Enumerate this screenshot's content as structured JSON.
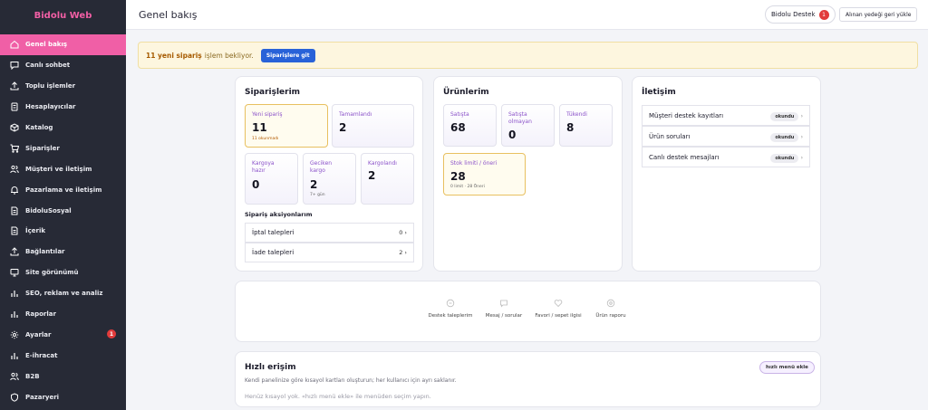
{
  "sidebar": {
    "brand": "Bidolu Web",
    "items": [
      {
        "label": "Genel bakış",
        "icon": "home-icon",
        "active": true
      },
      {
        "label": "Canlı sohbet",
        "icon": "chat-icon"
      },
      {
        "label": "Toplu işlemler",
        "icon": "upload-icon"
      },
      {
        "label": "Hesaplayıcılar",
        "icon": "calculator-icon"
      },
      {
        "label": "Katalog",
        "icon": "box-icon"
      },
      {
        "label": "Siparişler",
        "icon": "cart-icon"
      },
      {
        "label": "Müşteri ve iletişim",
        "icon": "users-icon"
      },
      {
        "label": "Pazarlama ve iletişim",
        "icon": "bell-icon"
      },
      {
        "label": "BidoluSosyal",
        "icon": "document-icon"
      },
      {
        "label": "İçerik",
        "icon": "document-icon"
      },
      {
        "label": "Bağlantılar",
        "icon": "upload-icon"
      },
      {
        "label": "Site görünümü",
        "icon": "monitor-icon"
      },
      {
        "label": "SEO, reklam ve analiz",
        "icon": "bar-chart-icon"
      },
      {
        "label": "Raporlar",
        "icon": "bar-chart-icon"
      },
      {
        "label": "Ayarlar",
        "icon": "settings-icon",
        "badge": "1"
      },
      {
        "label": "E-ihracat",
        "icon": "bar-chart-icon"
      },
      {
        "label": "B2B",
        "icon": "users-icon"
      },
      {
        "label": "Pazaryeri",
        "icon": "shield-icon"
      }
    ]
  },
  "header": {
    "title": "Genel bakış",
    "support_label": "Bidolu Destek",
    "support_badge": "1",
    "restore_label": "Alınan yedeği geri yükle"
  },
  "notice": {
    "bold": "11 yeni sipariş",
    "text": "işlem bekliyor.",
    "button": "Siparişlere git"
  },
  "orders": {
    "title": "Siparişlerim",
    "stats": [
      {
        "label": "Yeni sipariş",
        "value": "11",
        "sub": "11 okunmadı"
      },
      {
        "label": "Tamamlandı",
        "value": "2"
      },
      {
        "label": "Kargoya hazır",
        "value": "0"
      },
      {
        "label": "Geciken kargo",
        "value": "2",
        "sub": "7+ gün"
      },
      {
        "label": "Kargolandı",
        "value": "2"
      }
    ],
    "actions_title": "Sipariş aksiyonlarım",
    "actions": [
      {
        "label": "İptal talepleri",
        "count": "0 ›"
      },
      {
        "label": "İade talepleri",
        "count": "2 ›"
      }
    ]
  },
  "products": {
    "title": "Ürünlerim",
    "stats": [
      {
        "label": "Satışta",
        "value": "68"
      },
      {
        "label": "Satışta olmayan",
        "value": "0"
      },
      {
        "label": "Tükendi",
        "value": "8"
      },
      {
        "label": "Stok limiti / öneri",
        "value": "28",
        "sub": "0 limit · 28 Öneri"
      }
    ]
  },
  "contact": {
    "title": "İletişim",
    "rows": [
      {
        "label": "Müşteri destek kayıtları",
        "pill": "okundu",
        "arrow": "›"
      },
      {
        "label": "Ürün soruları",
        "pill": "okundu",
        "arrow": "›"
      },
      {
        "label": "Canlı destek mesajları",
        "pill": "okundu",
        "arrow": "›"
      }
    ]
  },
  "shortcuts": [
    {
      "label": "Destek taleplerim",
      "icon": "ticket-icon"
    },
    {
      "label": "Mesaj / sorular",
      "icon": "message-icon"
    },
    {
      "label": "Favori / sepet ilgisi",
      "icon": "heart-icon"
    },
    {
      "label": "Ürün raporu",
      "icon": "eye-icon"
    }
  ],
  "quick_access": {
    "title": "Hızlı erişim",
    "button": "hızlı menü ekle",
    "description": "Kendi panelinize göre kısayol kartları oluşturun; her kullanıcı için ayrı saklanır.",
    "empty": "Henüz kısayol yok. «hızlı menü ekle» ile menüden seçim yapın."
  },
  "colors": {
    "accent": "#f05fa6",
    "sidebar": "#272a36",
    "primary": "#2862d8",
    "label": "#8b52c9"
  }
}
